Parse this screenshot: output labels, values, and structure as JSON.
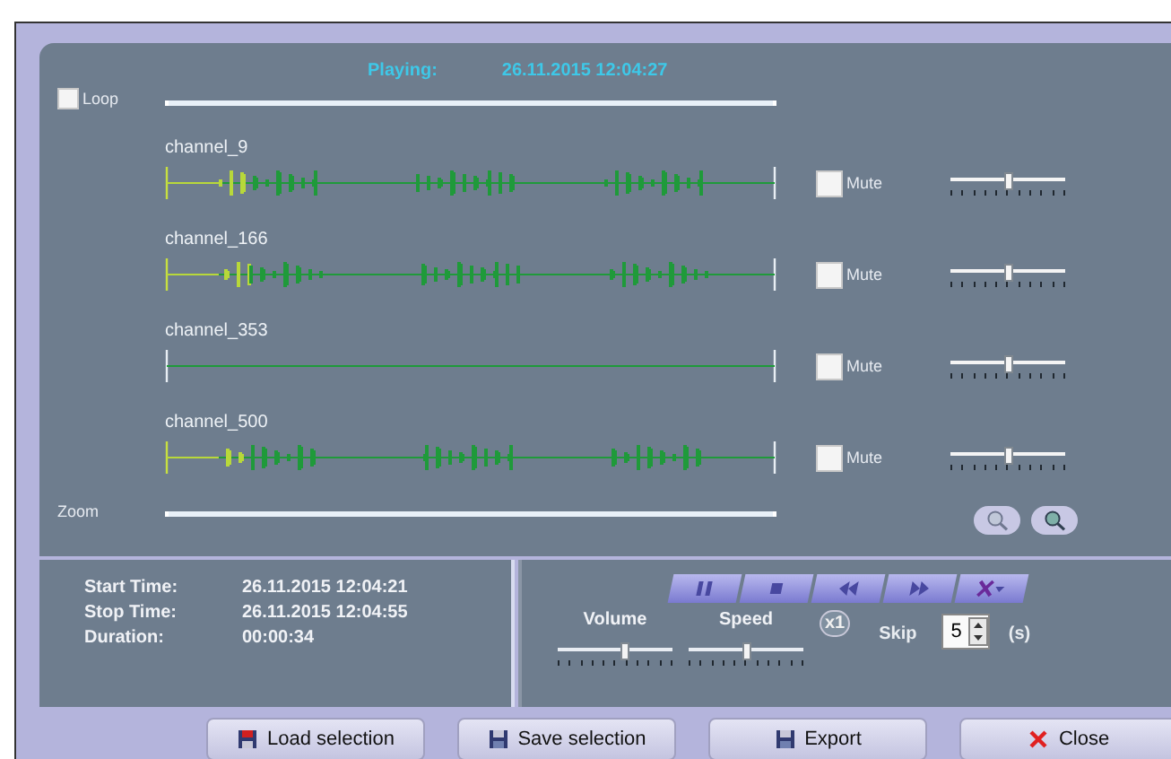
{
  "status": {
    "label": "Playing:",
    "time": "26.11.2015 12:04:27"
  },
  "loop": {
    "label": "Loop",
    "checked": false
  },
  "channels": [
    {
      "name": "channel_9",
      "kind": "signal",
      "mute_label": "Mute",
      "muted": false,
      "level": 0.5
    },
    {
      "name": "channel_166",
      "kind": "signal",
      "mute_label": "Mute",
      "muted": false,
      "level": 0.5
    },
    {
      "name": "channel_353",
      "kind": "silent",
      "mute_label": "Mute",
      "muted": false,
      "level": 0.5
    },
    {
      "name": "channel_500",
      "kind": "signal",
      "mute_label": "Mute",
      "muted": false,
      "level": 0.5
    }
  ],
  "zoom": {
    "label": "Zoom"
  },
  "info": [
    {
      "label": "Start Time:",
      "value": "26.11.2015 12:04:21"
    },
    {
      "label": "Stop Time:",
      "value": "26.11.2015 12:04:55"
    },
    {
      "label": "Duration:",
      "value": "00:00:34"
    }
  ],
  "volume": {
    "label": "Volume",
    "level": 0.58
  },
  "speed": {
    "label": "Speed",
    "level": 0.5,
    "multiplier": "x1"
  },
  "skip": {
    "label": "Skip",
    "value": "5",
    "unit": "(s)"
  },
  "buttons": [
    {
      "label": "Load selection",
      "kind": "load"
    },
    {
      "label": "Save selection",
      "kind": "save"
    },
    {
      "label": "Export",
      "kind": "export"
    },
    {
      "label": "Close",
      "kind": "close"
    }
  ]
}
